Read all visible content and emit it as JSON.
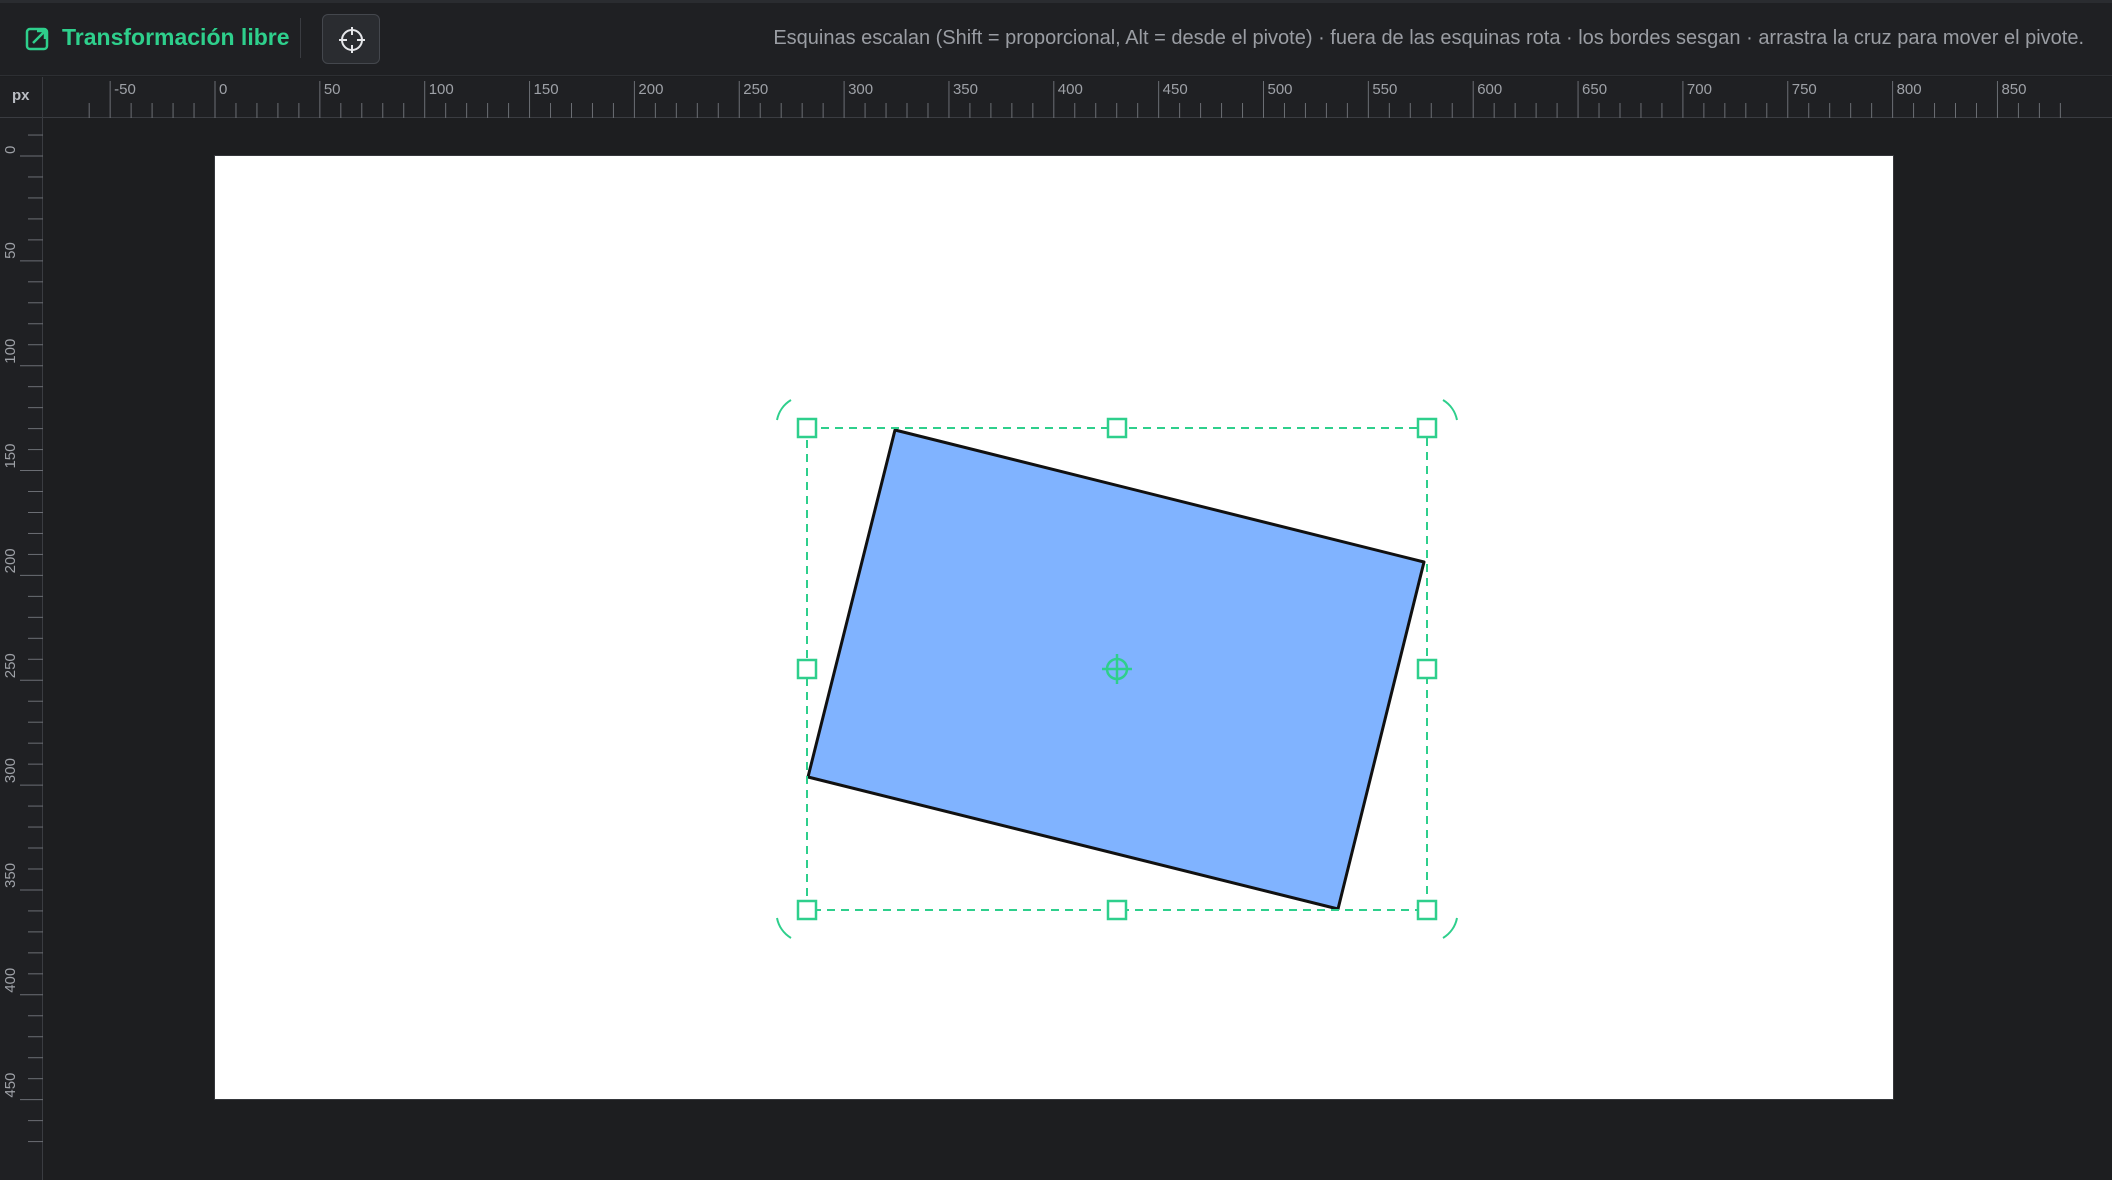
{
  "toolbar": {
    "tool_icon": "transform-arrow-icon",
    "title": "Transformación libre",
    "pivot_button_icon": "crosshair-icon",
    "hint": "Esquinas escalan (Shift = proporcional, Alt = desde el pivote) · fuera de las esquinas rota · los bordes sesgan · arrastra la cruz para mover el pivote."
  },
  "ruler": {
    "unit": "px",
    "horizontal_labels": [
      "-50",
      "0",
      "50",
      "100",
      "150",
      "200",
      "250",
      "300",
      "350",
      "400",
      "450",
      "500",
      "550",
      "600",
      "650",
      "700",
      "750",
      "800",
      "850"
    ],
    "vertical_labels": [
      "0",
      "50",
      "100",
      "150",
      "200",
      "250",
      "300",
      "350",
      "400",
      "450"
    ]
  },
  "canvas": {
    "background": "#ffffff"
  },
  "shape": {
    "fill": "#80b3ff",
    "stroke": "#111111"
  },
  "colors": {
    "accent": "#2ecf8c",
    "app_background": "#1d1e20",
    "toolbar_background": "#1f2023",
    "hint_text": "#9a9da3"
  }
}
